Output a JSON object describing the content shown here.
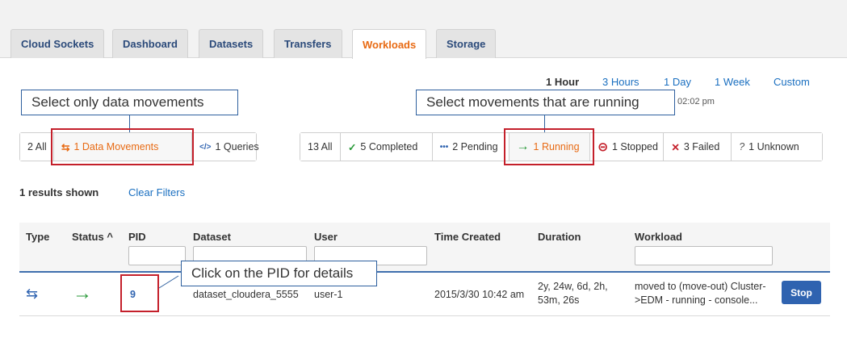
{
  "tabs": [
    {
      "label": "Cloud Sockets",
      "active": false
    },
    {
      "label": "Dashboard",
      "active": false
    },
    {
      "label": "Datasets",
      "active": false
    },
    {
      "label": "Transfers",
      "active": false
    },
    {
      "label": "Workloads",
      "active": true
    },
    {
      "label": "Storage",
      "active": false
    }
  ],
  "time_range": {
    "options": [
      "1 Hour",
      "3 Hours",
      "1 Day",
      "1 Week",
      "Custom"
    ],
    "selected": "1 Hour",
    "range_text": "— 02:02 pm"
  },
  "callouts": {
    "data_movements": "Select only data movements",
    "running": "Select movements that are running",
    "pid": "Click on the PID for details"
  },
  "type_filters": [
    {
      "label": "2 All",
      "icon": "",
      "selected": false
    },
    {
      "label": "1 Data Movements",
      "icon": "arrows-exchange-icon",
      "glyph": "⇆",
      "selected": true
    },
    {
      "label": "1 Queries",
      "icon": "code-icon",
      "glyph": "</>",
      "selected": false
    }
  ],
  "status_filters": [
    {
      "label": "13 All",
      "icon": "",
      "glyph": "",
      "selected": false
    },
    {
      "label": "5 Completed",
      "icon": "check-icon",
      "glyph": "✓",
      "color": "#2a9a3a",
      "selected": false
    },
    {
      "label": "2 Pending",
      "icon": "dots-icon",
      "glyph": "•••",
      "color": "#2f63b0",
      "selected": false
    },
    {
      "label": "1 Running",
      "icon": "arrow-right-icon",
      "glyph": "→",
      "color": "#2a9a3a",
      "selected": true
    },
    {
      "label": "1 Stopped",
      "icon": "stop-circle-icon",
      "glyph": "⊝",
      "color": "#c4202b",
      "selected": false
    },
    {
      "label": "3 Failed",
      "icon": "x-icon",
      "glyph": "✕",
      "color": "#c4202b",
      "selected": false
    },
    {
      "label": "1 Unknown",
      "icon": "question-icon",
      "glyph": "?",
      "color": "#555",
      "selected": false
    }
  ],
  "results": {
    "shown": "1 results shown",
    "clear": "Clear Filters"
  },
  "table": {
    "columns": [
      "Type",
      "Status ^",
      "PID",
      "Dataset",
      "User",
      "Time Created",
      "Duration",
      "Workload"
    ],
    "rows": [
      {
        "type_icon": "⇆",
        "status_icon": "→",
        "pid": "9",
        "dataset": "dataset_cloudera_5555",
        "user": "user-1",
        "time_created": "2015/3/30 10:42 am",
        "duration_1": "2y, 24w, 6d, 2h,",
        "duration_2": "53m, 26s",
        "workload_1": "moved to (move-out) Cluster-",
        "workload_2": ">EDM - running - console...",
        "action": "Stop"
      }
    ]
  },
  "colors": {
    "accent": "#e86a13",
    "link": "#1a6fc0",
    "highlight": "#c4202b",
    "callout_border": "#2d5f9e",
    "button": "#2f63b0"
  }
}
